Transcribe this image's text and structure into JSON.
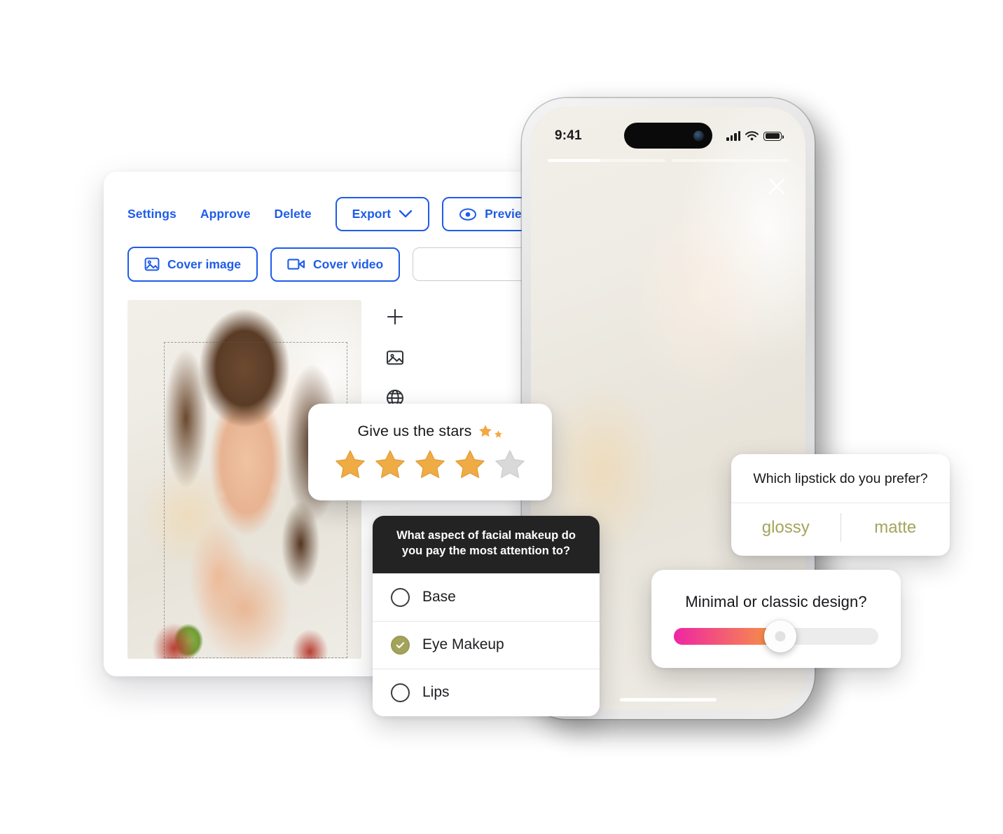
{
  "editor": {
    "toolbar_primary": [
      {
        "label": "Settings",
        "name": "settings"
      },
      {
        "label": "Approve",
        "name": "approve"
      },
      {
        "label": "Delete",
        "name": "delete"
      }
    ],
    "export_button": {
      "label": "Export",
      "icon": "chevron-down-icon"
    },
    "preview_button": {
      "label": "Preview",
      "icon": "eye-icon"
    },
    "cover_image_button": {
      "label": "Cover image",
      "icon": "image-icon"
    },
    "cover_video_button": {
      "label": "Cover video",
      "icon": "video-icon"
    },
    "search_input": {
      "value": "",
      "placeholder": ""
    },
    "side_tools": [
      {
        "name": "add-plus-icon"
      },
      {
        "name": "image-icon"
      },
      {
        "name": "globe-icon"
      }
    ],
    "accent_color": "#1f5ce8",
    "input_border_color": "#c9cbd1"
  },
  "phone": {
    "status_bar": {
      "time": "9:41",
      "signal_icon": "cellular-signal-icon",
      "wifi_icon": "wifi-icon",
      "battery_icon": "battery-icon"
    },
    "story_progress": [
      45,
      0
    ],
    "close_icon": "close-icon",
    "home_indicator": "home-indicator"
  },
  "stars_card": {
    "title": "Give us the stars",
    "decorative_icons": [
      "star-icon",
      "star-icon-small"
    ],
    "rating": 4,
    "max_rating": 5,
    "filled_color": "#f0a93b",
    "empty_color": "#d9d9d9"
  },
  "poll_card": {
    "question": "What aspect of facial makeup do you pay the most attention to?",
    "options": [
      {
        "label": "Base",
        "selected": false
      },
      {
        "label": "Eye Makeup",
        "selected": true
      },
      {
        "label": "Lips",
        "selected": false
      }
    ],
    "header_bg": "#232323",
    "selected_color": "#a3a35c"
  },
  "lipstick_card": {
    "question": "Which lipstick do you prefer?",
    "options": [
      "glossy",
      "matte"
    ],
    "option_color": "#a4a45e"
  },
  "slider_card": {
    "question": "Minimal or classic design?",
    "value_percent": 52,
    "gradient_from": "#ef25a4",
    "gradient_to": "#f79b3d"
  }
}
